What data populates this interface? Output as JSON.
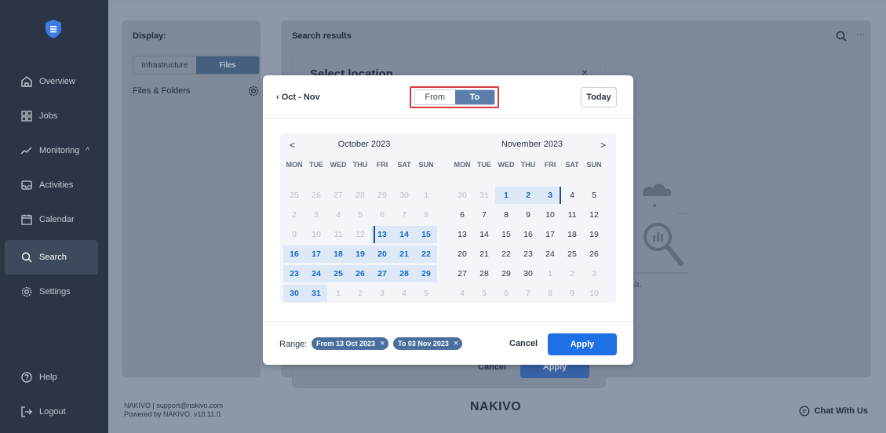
{
  "sidebar": {
    "items": [
      {
        "label": "Overview",
        "icon": "home-icon"
      },
      {
        "label": "Jobs",
        "icon": "grid-icon"
      },
      {
        "label": "Monitoring",
        "icon": "chart-line-icon",
        "chevron": "^"
      },
      {
        "label": "Activities",
        "icon": "inbox-icon"
      },
      {
        "label": "Calendar",
        "icon": "calendar-icon"
      },
      {
        "label": "Search",
        "icon": "search-icon",
        "active": true
      },
      {
        "label": "Settings",
        "icon": "gear-icon"
      }
    ],
    "help": "Help",
    "logout": "Logout"
  },
  "left_panel": {
    "title": "Display:",
    "tabs": [
      "Infrastructure",
      "Files"
    ],
    "active_tab": "Files",
    "row_label": "Files & Folders"
  },
  "right_panel": {
    "title": "Search results",
    "hint_fragment": "aria.",
    "more": "···"
  },
  "select_location": {
    "title": "Select location",
    "close": "×",
    "cancel": "Cancel",
    "apply": "Apply"
  },
  "date_dialog": {
    "back_label": "Oct - Nov",
    "toggle": {
      "from": "From",
      "to": "To",
      "active": "To"
    },
    "today": "Today",
    "weekdays": [
      "MON",
      "TUE",
      "WED",
      "THU",
      "FRI",
      "SAT",
      "SUN"
    ],
    "months": [
      {
        "title": "October 2023",
        "prev_arrow": "<",
        "weeks": [
          [
            "25",
            "26",
            "27",
            "28",
            "29",
            "30",
            "1"
          ],
          [
            "2",
            "3",
            "4",
            "5",
            "6",
            "7",
            "8"
          ],
          [
            "9",
            "10",
            "11",
            "12",
            "13",
            "14",
            "15"
          ],
          [
            "16",
            "17",
            "18",
            "19",
            "20",
            "21",
            "22"
          ],
          [
            "23",
            "24",
            "25",
            "26",
            "27",
            "28",
            "29"
          ],
          [
            "30",
            "31",
            "1",
            "2",
            "3",
            "4",
            "5"
          ]
        ]
      },
      {
        "title": "November 2023",
        "next_arrow": ">",
        "weeks": [
          [
            "30",
            "31",
            "1",
            "2",
            "3",
            "4",
            "5"
          ],
          [
            "6",
            "7",
            "8",
            "9",
            "10",
            "11",
            "12"
          ],
          [
            "13",
            "14",
            "15",
            "16",
            "17",
            "18",
            "19"
          ],
          [
            "20",
            "21",
            "22",
            "23",
            "24",
            "25",
            "26"
          ],
          [
            "27",
            "28",
            "29",
            "30",
            "1",
            "2",
            "3"
          ],
          [
            "4",
            "5",
            "6",
            "7",
            "8",
            "9",
            "10"
          ]
        ]
      }
    ],
    "range_label": "Range:",
    "chips": [
      "From 13 Oct 2023",
      "To 03 Nov 2023"
    ],
    "chip_close": "×",
    "cancel": "Cancel",
    "apply": "Apply"
  },
  "footer": {
    "line1": "NAKIVO | support@nakivo.com",
    "line2": "Powered by NAKIVO. v10.11.0.",
    "logo": "NAKIVO",
    "chat": "Chat With Us"
  },
  "colors": {
    "sidebar": "#2b3545",
    "accent": "#1f6fe5",
    "selected_day": "#1a67c2",
    "range_fill": "#dde9f7",
    "highlight_outline": "#d9383a"
  }
}
